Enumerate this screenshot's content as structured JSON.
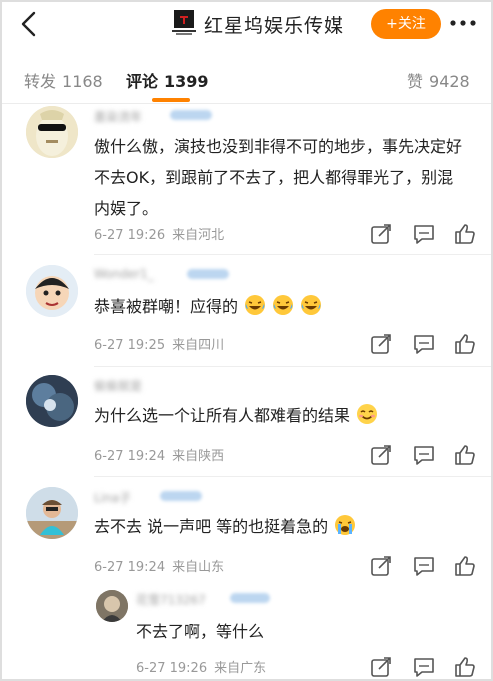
{
  "header": {
    "title": "红星坞娱乐传媒",
    "follow_label": "+关注",
    "logo_text": "红星坞"
  },
  "tabs": [
    {
      "label": "转发",
      "count": "1168"
    },
    {
      "label": "评论",
      "count": "1399"
    },
    {
      "label": "赞",
      "count": "9428"
    }
  ],
  "comments": [
    {
      "username": "墨染流年",
      "text": "傲什么傲，演技也没到非得不可的地步，事先决定好不去OK，到跟前了不去了，把人都得罪光了，别混内娱了。",
      "time": "6-27 19:26",
      "location": "来自河北",
      "emoji_count": 0
    },
    {
      "username": "Wonder1_",
      "text": "恭喜被群嘲！应得的",
      "time": "6-27 19:25",
      "location": "来自四川",
      "emoji_count": 3
    },
    {
      "username": "偷偷就是",
      "text": "为什么选一个让所有人都难看的结果",
      "time": "6-27 19:24",
      "location": "来自陕西",
      "emoji_count": 1
    },
    {
      "username": "Lina子",
      "text": "去不去 说一声吧 等的也挺着急的",
      "time": "6-27 19:24",
      "location": "来自山东",
      "emoji_count": 1
    },
    {
      "username": "花雪713267",
      "text": "不去了啊，等什么",
      "time": "6-27 19:26",
      "location": "来自广东",
      "emoji_count": 0
    }
  ],
  "icons": {
    "back": "chevron-left-icon",
    "more": "ellipsis-icon",
    "share": "share-icon",
    "reply": "comment-icon",
    "like": "thumbs-up-icon"
  },
  "colors": {
    "accent": "#ff8200",
    "text": "#222222",
    "meta": "#999999"
  }
}
